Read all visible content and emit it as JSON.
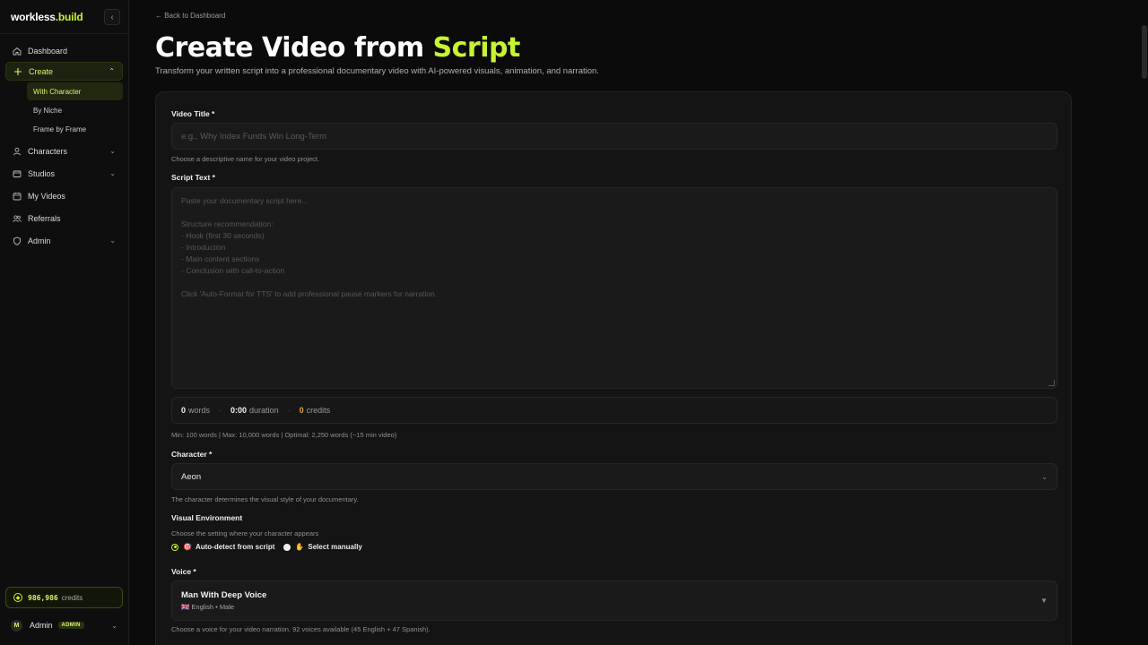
{
  "brand": {
    "name": "workless",
    "tld": ".build"
  },
  "sidebar": {
    "items": [
      {
        "label": "Dashboard"
      },
      {
        "label": "Create"
      },
      {
        "label": "Characters"
      },
      {
        "label": "Studios"
      },
      {
        "label": "My Videos"
      },
      {
        "label": "Referrals"
      },
      {
        "label": "Admin"
      }
    ],
    "create_sub": [
      {
        "label": "With Character"
      },
      {
        "label": "By Niche"
      },
      {
        "label": "Frame by Frame"
      }
    ],
    "credits": {
      "amount": "986,986",
      "label": "credits"
    },
    "user": {
      "initial": "M",
      "name": "Admin",
      "badge": "ADMIN"
    }
  },
  "main": {
    "back": "← Back to Dashboard",
    "title_main": "Create Video from ",
    "title_accent": "Script",
    "subtitle": "Transform your written script into a professional documentary video with AI-powered visuals, animation, and narration."
  },
  "form": {
    "title_label": "Video Title *",
    "title_placeholder": "e.g., Why Index Funds Win Long-Term",
    "title_help": "Choose a descriptive name for your video project.",
    "script_label": "Script Text *",
    "script_placeholder_lines": [
      "Paste your documentary script here...",
      "",
      "Structure recommendation:",
      "- Hook (first 30 seconds)",
      "- Introduction",
      "- Main content sections",
      "- Conclusion with call-to-action",
      "",
      "Click 'Auto-Format for TTS' to add professional pause markers for narration."
    ],
    "stats": {
      "words_value": "0",
      "words_label": "words",
      "duration_value": "0:00",
      "duration_label": "duration",
      "credits_value": "0",
      "credits_label": "credits"
    },
    "limits": "Min: 100 words | Max: 10,000 words | Optimal: 2,250 words (~15 min video)",
    "character_label": "Character *",
    "character_value": "Aeon",
    "character_help": "The character determines the visual style of your documentary.",
    "env_label": "Visual Environment",
    "env_help": "Choose the setting where your character appears",
    "env_opt1_emoji": "🎯",
    "env_opt1": "Auto-detect from script",
    "env_opt2_emoji": "✋",
    "env_opt2": "Select manually",
    "voice_label": "Voice *",
    "voice_name": "Man With Deep Voice",
    "voice_meta": "🇬🇧 English • Male",
    "voice_help": "Choose a voice for your video narration. 92 voices available (45 English + 47 Spanish)."
  },
  "colors": {
    "accent": "#c6f432",
    "credits": "#e2a632"
  }
}
